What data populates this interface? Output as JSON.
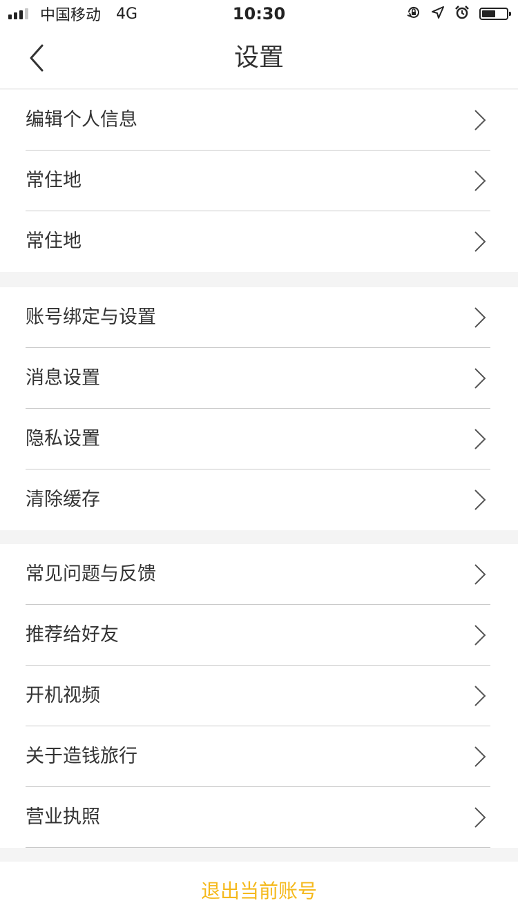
{
  "status_bar": {
    "carrier": "中国移动",
    "network": "4G",
    "time": "10:30",
    "battery_level": 0.6,
    "icons": [
      "signal-icon",
      "orientation-lock-icon",
      "location-icon",
      "alarm-icon",
      "battery-icon"
    ]
  },
  "nav": {
    "back_icon": "chevron-left-icon",
    "title": "设置"
  },
  "groups": [
    {
      "items": [
        {
          "label": "编辑个人信息",
          "name": "edit-profile"
        },
        {
          "label": "常住地",
          "name": "residence-1"
        },
        {
          "label": "常住地",
          "name": "residence-2"
        }
      ]
    },
    {
      "items": [
        {
          "label": "账号绑定与设置",
          "name": "account-binding"
        },
        {
          "label": "消息设置",
          "name": "message-settings"
        },
        {
          "label": "隐私设置",
          "name": "privacy-settings"
        },
        {
          "label": "清除缓存",
          "name": "clear-cache"
        }
      ]
    },
    {
      "items": [
        {
          "label": "常见问题与反馈",
          "name": "faq-feedback"
        },
        {
          "label": "推荐给好友",
          "name": "recommend-friends"
        },
        {
          "label": "开机视频",
          "name": "launch-video"
        },
        {
          "label": "关于造钱旅行",
          "name": "about"
        },
        {
          "label": "营业执照",
          "name": "business-license"
        }
      ]
    }
  ],
  "logout": {
    "label": "退出当前账号",
    "color": "#f5b91c"
  },
  "colors": {
    "background": "#f4f4f4",
    "card": "#ffffff",
    "text": "#333333",
    "divider": "#c9c9c9",
    "accent": "#f5b91c"
  }
}
